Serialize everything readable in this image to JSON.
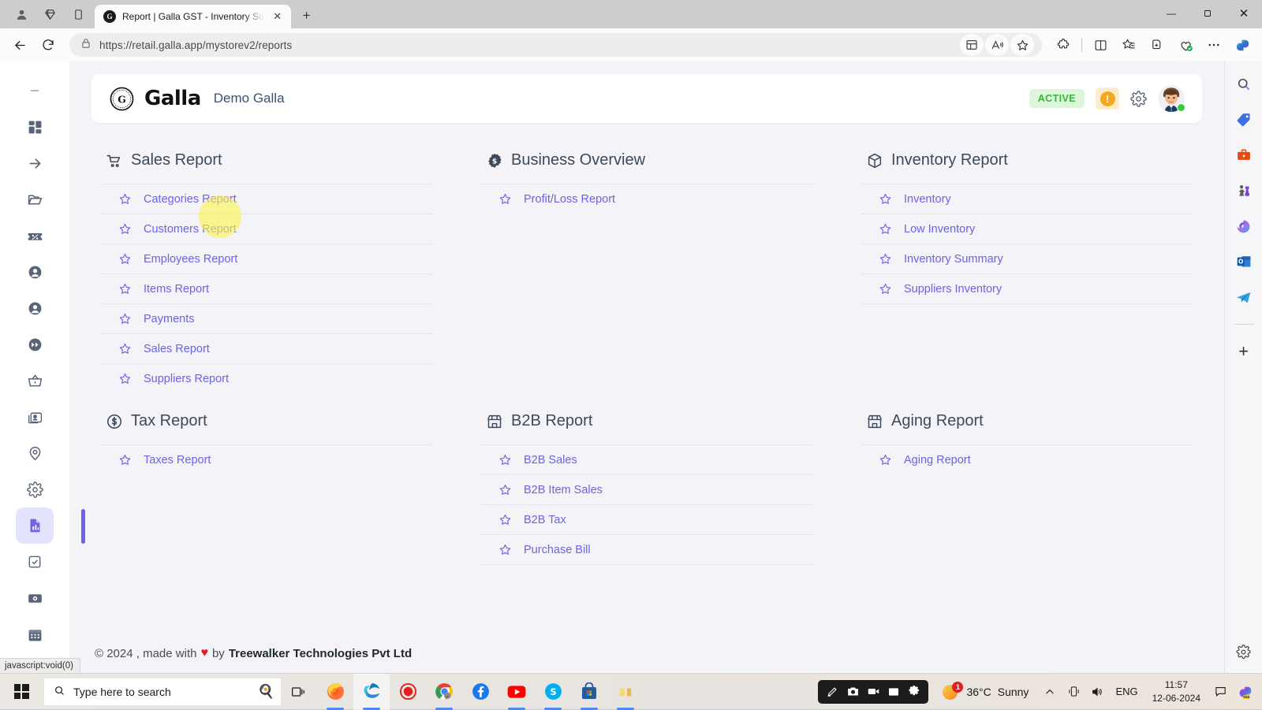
{
  "browser": {
    "tab": {
      "title": "Report | Galla GST - Inventory So",
      "favicon_letter": "G"
    },
    "url": "https://retail.galla.app/mystorev2/reports",
    "new_tab_label": "+",
    "window_controls": {
      "minimize": "—",
      "maximize": "❑",
      "close": "✕"
    },
    "toolbar_icons": [
      "back-icon",
      "refresh-icon",
      "lock-icon",
      "split-screen-add-icon",
      "read-aloud-icon",
      "favorite-star-icon",
      "extensions-icon",
      "split-screen-icon",
      "collections-icon",
      "tab-actions-icon",
      "browser-essentials-icon",
      "more-settings-icon",
      "copilot-icon"
    ]
  },
  "app": {
    "brand_name": "Galla",
    "store_name": "Demo Galla",
    "status_badge": "ACTIVE",
    "warning_mark": "!",
    "header_icons": [
      "gear-icon",
      "avatar"
    ]
  },
  "sidebar": {
    "items": [
      {
        "name": "collapse-dash",
        "icon": "minus-icon"
      },
      {
        "name": "dashboard",
        "icon": "grid-icon"
      },
      {
        "name": "transfer",
        "icon": "arrow-right-icon"
      },
      {
        "name": "folder",
        "icon": "folder-icon"
      },
      {
        "name": "discounts",
        "icon": "ticket-percent-icon"
      },
      {
        "name": "customers",
        "icon": "person-circle-icon"
      },
      {
        "name": "users",
        "icon": "person-circle-icon"
      },
      {
        "name": "fast-forward",
        "icon": "fast-forward-icon"
      },
      {
        "name": "purchases",
        "icon": "basket-icon"
      },
      {
        "name": "contacts",
        "icon": "contact-card-icon"
      },
      {
        "name": "locations",
        "icon": "map-pin-icon"
      },
      {
        "name": "settings",
        "icon": "gear-icon"
      },
      {
        "name": "reports",
        "icon": "report-document-icon",
        "active": true
      },
      {
        "name": "tasks",
        "icon": "checkbox-icon"
      },
      {
        "name": "payments",
        "icon": "cash-icon"
      },
      {
        "name": "calendar",
        "icon": "calendar-icon"
      }
    ]
  },
  "sections": [
    {
      "title": "Sales Report",
      "icon": "shopping-cart-icon",
      "items": [
        "Categories Report",
        "Customers Report",
        "Employees Report",
        "Items Report",
        "Payments",
        "Sales Report",
        "Suppliers Report"
      ]
    },
    {
      "title": "Business Overview",
      "icon": "dollar-badge-icon",
      "items": [
        "Profit/Loss Report"
      ]
    },
    {
      "title": "Inventory Report",
      "icon": "box-icon",
      "items": [
        "Inventory",
        "Low Inventory",
        "Inventory Summary",
        "Suppliers Inventory"
      ]
    },
    {
      "title": "Tax Report",
      "icon": "dollar-circle-icon",
      "items": [
        "Taxes Report"
      ]
    },
    {
      "title": "B2B Report",
      "icon": "storefront-icon",
      "items": [
        "B2B Sales",
        "B2B Item Sales",
        "B2B Tax",
        "Purchase Bill"
      ]
    },
    {
      "title": "Aging Report",
      "icon": "storefront-icon",
      "items": [
        "Aging Report"
      ]
    }
  ],
  "footer": {
    "copyright": "© 2024 , made with",
    "heart": "♥",
    "by": "by",
    "company": "Treewalker Technologies Pvt Ltd"
  },
  "status_link": "javascript:void(0)",
  "edge_sidebar": {
    "items": [
      "search-icon",
      "shopping-tag-icon",
      "tools-briefcase-icon",
      "games-chess-icon",
      "microsoft-365-icon",
      "outlook-icon",
      "telegram-icon"
    ],
    "add_label": "+"
  },
  "taskbar": {
    "search_placeholder": "Type here to search",
    "search_emoji": "🍳",
    "apps": [
      "task-view-icon",
      "firefox-icon",
      "edge-icon",
      "screen-recorder-icon",
      "chrome-icon",
      "facebook-icon",
      "youtube-icon",
      "skype-icon",
      "microsoft-store-icon",
      "notes-icon"
    ],
    "recorder_icons": [
      "pen-icon",
      "camera-icon",
      "video-icon",
      "window-icon",
      "settings-gear-icon"
    ],
    "weather_temp": "36°C",
    "weather_desc": "Sunny",
    "weather_badge": "1",
    "language": "ENG",
    "time": "11:57",
    "date": "12-06-2024"
  },
  "colors": {
    "link": "#6c63e8",
    "accent": "#6c63e8",
    "page_bg": "#f3f3f8",
    "active_badge_bg": "#ddf5dd",
    "active_badge_text": "#37b537",
    "warn_bg": "#fdeccb",
    "warn_dot": "#f5a623",
    "heart": "#e02020",
    "highlight": "#fbf34d"
  }
}
